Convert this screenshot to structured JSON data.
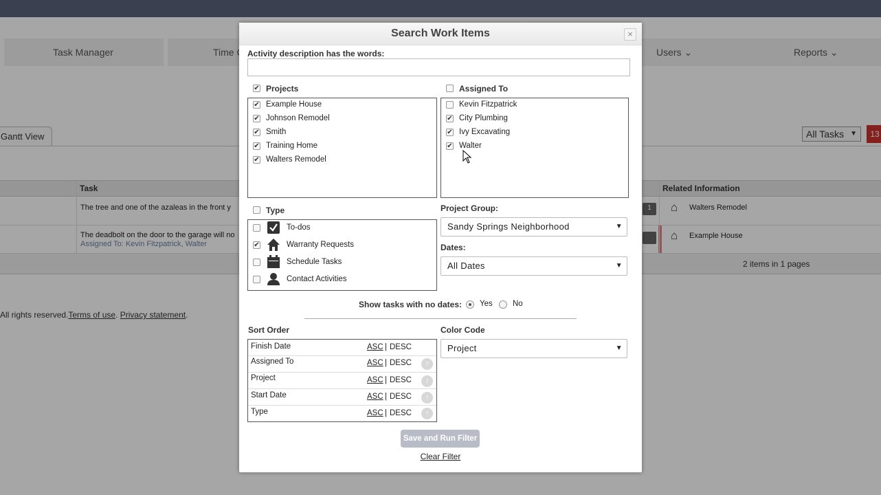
{
  "background": {
    "nav": [
      "Task Manager",
      "Time C",
      "Users",
      "Reports"
    ],
    "gantt_tab": "Gantt View",
    "all_tasks_select": "All Tasks",
    "red_badge": "13",
    "grid_headers": {
      "task": "Task",
      "related": "Related Information"
    },
    "rows": [
      {
        "task": "The tree and one of the azaleas in the front y",
        "sub": "",
        "related": "Walters Remodel",
        "comment_count": "1"
      },
      {
        "task": "The deadbolt on the door to the garage will no",
        "sub": "Assigned To: Kevin Fitzpatrick, Walter",
        "related": "Example House",
        "comment_count": ""
      }
    ],
    "pager": "2 items in 1 pages",
    "footer": {
      "prefix": "All rights reserved.",
      "terms": "Terms of use",
      "sep": ".",
      "privacy": "Privacy statement",
      "suffix": "."
    }
  },
  "modal": {
    "title": "Search Work Items",
    "close": "×",
    "activity_label": "Activity description has the words:",
    "activity_value": "",
    "projects": {
      "label": "Projects",
      "all_checked": true,
      "items": [
        {
          "label": "Example House",
          "checked": true
        },
        {
          "label": "Johnson Remodel",
          "checked": true
        },
        {
          "label": "Smith",
          "checked": true
        },
        {
          "label": "Training Home",
          "checked": true
        },
        {
          "label": "Walters Remodel",
          "checked": true
        }
      ]
    },
    "assigned": {
      "label": "Assigned To",
      "all_checked": false,
      "items": [
        {
          "label": "Kevin Fitzpatrick",
          "checked": false
        },
        {
          "label": "City Plumbing",
          "checked": true
        },
        {
          "label": "Ivy Excavating",
          "checked": true
        },
        {
          "label": "Walter",
          "checked": true
        }
      ]
    },
    "type": {
      "label": "Type",
      "all_checked": false,
      "items": [
        {
          "label": "To-dos",
          "checked": false,
          "icon": "checkbox-icon"
        },
        {
          "label": "Warranty Requests",
          "checked": true,
          "icon": "house-icon"
        },
        {
          "label": "Schedule Tasks",
          "checked": false,
          "icon": "calendar-icon"
        },
        {
          "label": "Contact Activities",
          "checked": false,
          "icon": "person-icon"
        }
      ]
    },
    "project_group": {
      "label": "Project Group:",
      "value": "Sandy Springs Neighborhood"
    },
    "dates": {
      "label": "Dates:",
      "value": "All Dates"
    },
    "no_dates": {
      "label": "Show tasks with no dates:",
      "yes": "Yes",
      "no": "No",
      "selected": "Yes"
    },
    "sort_order": {
      "label": "Sort Order",
      "asc": "ASC",
      "pipe": "|",
      "desc": "DESC",
      "rows": [
        "Finish Date",
        "Assigned To",
        "Project",
        "Start Date",
        "Type"
      ]
    },
    "color_code": {
      "label": "Color Code",
      "value": "Project"
    },
    "save_button": "Save and Run Filter",
    "clear_link": "Clear Filter"
  },
  "colors": {
    "overlay": "#000000",
    "badge": "#c9302c",
    "topbar": "#3b4050"
  }
}
